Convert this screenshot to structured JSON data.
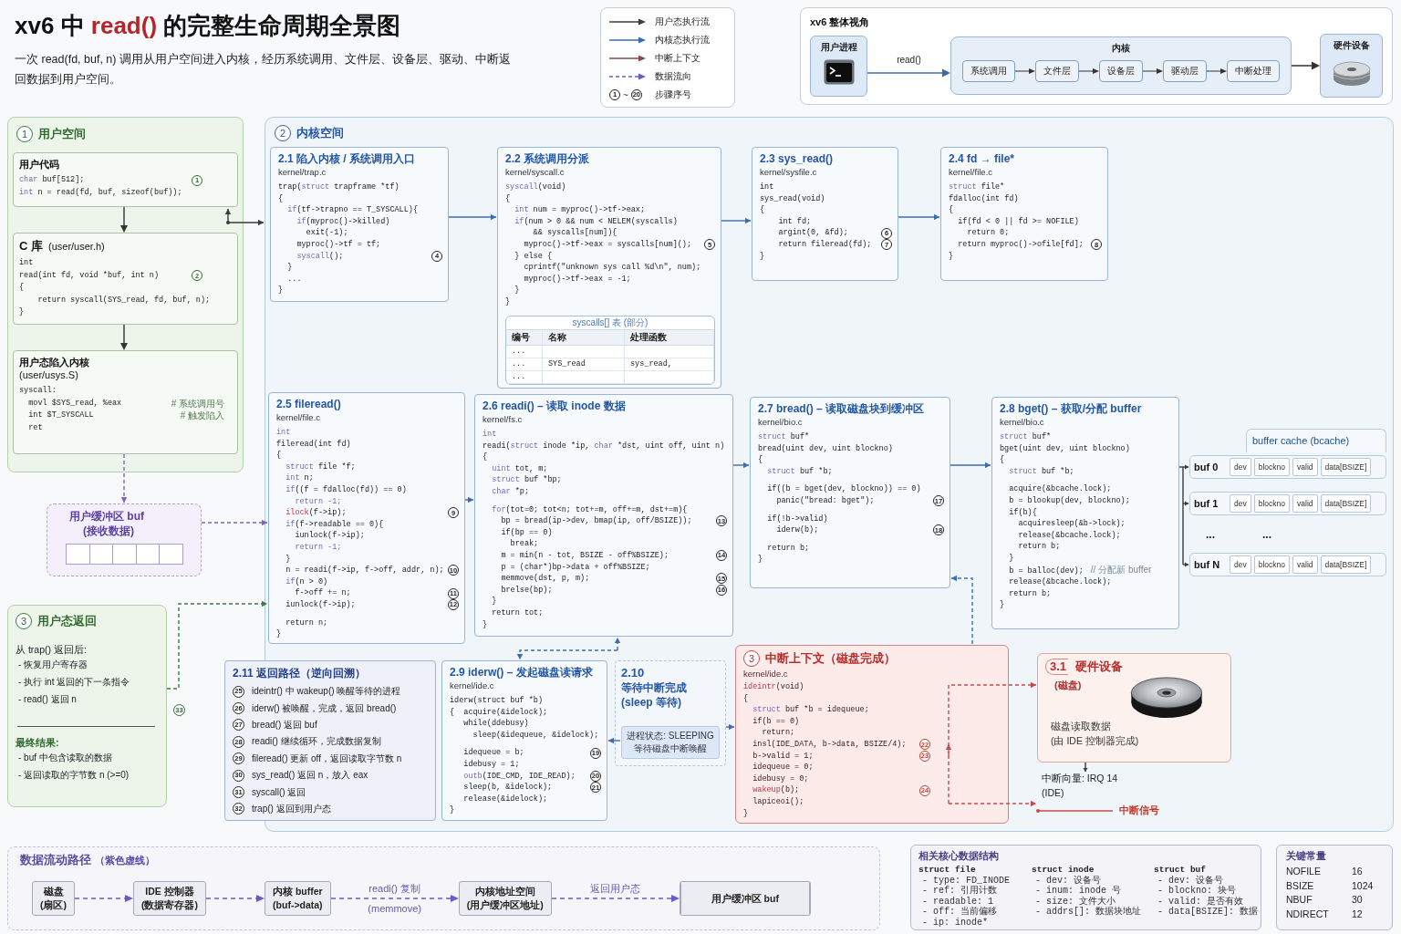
{
  "header": {
    "title_lead": "xv6 中",
    "title_code": "read()",
    "title_rest": "的完整生命周期全景图",
    "subtitle": "一次 read(fd, buf, n) 调用从用户空间进入内核，经历系统调用、文件层、设备层、驱动、中断返回数据到用户空间。"
  },
  "legend": {
    "items": [
      {
        "kind": "user",
        "label": "用户态执行流"
      },
      {
        "kind": "kernel",
        "label": "内核态执行流"
      },
      {
        "kind": "interrupt",
        "label": "中断上下文"
      },
      {
        "kind": "data",
        "label": "数据流向"
      },
      {
        "kind": "steps",
        "first": "1",
        "between": "~",
        "last": "20",
        "label": "步骤序号"
      }
    ]
  },
  "overview": {
    "title": "xv6 整体视角",
    "process": {
      "label": "用户进程"
    },
    "call_label": "read()",
    "kernel": {
      "label": "内核",
      "layers": [
        "系统调用",
        "文件层",
        "设备层",
        "驱动层",
        "中断处理"
      ]
    },
    "hardware": {
      "label": "硬件设备"
    }
  },
  "user_space": {
    "number": "1",
    "title": "用户空间",
    "blocks": [
      {
        "kind": "snippet",
        "title": "用户代码",
        "code": [
          [
            {
              "parts": [
                {
                  "kind": "keyword",
                  "text": "char"
                },
                {
                  "kind": "plain",
                  "text": " buf[512];"
                }
              ],
              "step": "1"
            },
            {
              "parts": [
                {
                  "kind": "keyword",
                  "text": "int"
                },
                {
                  "kind": "plain",
                  "text": " n = read(fd, buf, sizeof(buf));"
                }
              ]
            }
          ]
        ]
      },
      {
        "kind": "library",
        "title": "C 库",
        "path": "(user/user.h)",
        "code": [
          [
            "int",
            {
              "text": "read(int fd, void *buf, int n)",
              "step": "2"
            },
            "{",
            "    return syscall(SYS_read, fd, buf, n);",
            "}"
          ]
        ]
      },
      {
        "kind": "stub",
        "title": "用户态陷入内核",
        "path": "(user/usys.S)",
        "code": [
          [
            "syscall:",
            {
              "parts": [
                {
                  "kind": "plain",
                  "text": "  movl $SYS_read, %eax"
                },
                {
                  "kind": "note",
                  "text": "# 系统调用号"
                }
              ]
            },
            {
              "parts": [
                {
                  "kind": "plain",
                  "text": "  int $T_SYSCALL"
                },
                {
                  "kind": "note",
                  "text": "# 触发陷入"
                }
              ]
            },
            "  ret"
          ]
        ]
      }
    ]
  },
  "user_buffer": {
    "title": "用户缓冲区 buf",
    "subtitle": "(接收数据)"
  },
  "user_return": {
    "number": "3",
    "title": "用户态返回",
    "intro": "从 trap() 返回后:",
    "steps": [
      "- 恢复用户寄存器",
      "- 执行 int 返回的下一条指令",
      "- read() 返回 n"
    ],
    "result_title": "最终结果:",
    "results": [
      "- buf 中包含读取的数据",
      "- 返回读取的字节数 n (>=0)"
    ],
    "step": "33"
  },
  "kernel_space": {
    "number": "2",
    "title": "内核空间",
    "cards": [
      {
        "title": "2.1 陷入内核 / 系统调用入口",
        "file": "kernel/trap.c",
        "code": [
          [
            {
              "parts": [
                {
                  "kind": "plain",
                  "text": "trap("
                },
                {
                  "kind": "keyword",
                  "text": "struct"
                },
                {
                  "kind": "plain",
                  "text": " trapframe *tf)"
                }
              ]
            },
            "{",
            {
              "parts": [
                {
                  "kind": "keyword",
                  "text": "  if"
                },
                {
                  "kind": "plain",
                  "text": "(tf->trapno == T_SYSCALL){"
                }
              ]
            },
            {
              "parts": [
                {
                  "kind": "keyword",
                  "text": "    if"
                },
                {
                  "kind": "plain",
                  "text": "(myproc()->killed)"
                }
              ]
            },
            "      exit(-1);",
            "    myproc()->tf = tf;",
            {
              "parts": [
                {
                  "kind": "keyword",
                  "text": "    syscall"
                },
                {
                  "kind": "plain",
                  "text": "();"
                }
              ],
              "step": "4"
            },
            "  }",
            "  ...",
            "}"
          ]
        ]
      },
      {
        "title": "2.2 系统调用分派",
        "file": "kernel/syscall.c",
        "code": [
          [
            {
              "parts": [
                {
                  "kind": "keyword",
                  "text": "syscall"
                },
                {
                  "kind": "plain",
                  "text": "(void)"
                }
              ]
            },
            "{",
            {
              "parts": [
                {
                  "kind": "keyword",
                  "text": "  int"
                },
                {
                  "kind": "plain",
                  "text": " num = myproc()->tf->eax;"
                }
              ]
            },
            {
              "parts": [
                {
                  "kind": "keyword",
                  "text": "  if"
                },
                {
                  "kind": "plain",
                  "text": "(num > 0 && num < NELEM(syscalls)"
                }
              ]
            },
            "      && syscalls[num]){",
            {
              "text": "    myproc()->tf->eax = syscalls[num]();",
              "step": "5"
            },
            "  } else {",
            "    cprintf(\"unknown sys call %d\\n\", num);",
            "    myproc()->tf->eax = -1;",
            "  }",
            "}"
          ]
        ],
        "table": {
          "caption": "syscalls[] 表 (部分)",
          "columns": [
            "编号",
            "名称",
            "处理函数"
          ],
          "rows": [
            [
              "..."
            ],
            [
              "...",
              "SYS_read",
              "sys_read,"
            ],
            [
              "..."
            ]
          ]
        }
      },
      {
        "title": "2.3 sys_read()",
        "file": "kernel/sysfile.c",
        "code": [
          [
            "int",
            "sys_read(void)",
            "{",
            "    int fd;",
            {
              "text": "    argint(0, &fd);",
              "step": "6"
            },
            {
              "text": "    return fileread(fd);",
              "step": "7"
            },
            "}"
          ]
        ]
      },
      {
        "title": "2.4 fd → file*",
        "file": "kernel/file.c",
        "code": [
          [
            {
              "parts": [
                {
                  "kind": "keyword",
                  "text": "struct"
                },
                {
                  "kind": "plain",
                  "text": " file*"
                }
              ]
            },
            "fdalloc(int fd)",
            "{",
            "  if(fd < 0 || fd >= NOFILE)",
            "    return 0;",
            {
              "text": "  return myproc()->ofile[fd];",
              "step": "8"
            },
            "}"
          ]
        ]
      },
      {
        "title": "2.5 fileread()",
        "file": "kernel/file.c",
        "code": [
          [
            {
              "parts": [
                {
                  "kind": "keyword",
                  "text": "int"
                }
              ]
            },
            "fileread(int fd)",
            "{",
            {
              "parts": [
                {
                  "kind": "keyword",
                  "text": "  struct"
                },
                {
                  "kind": "plain",
                  "text": " file *f;"
                }
              ]
            },
            {
              "parts": [
                {
                  "kind": "keyword",
                  "text": "  int"
                },
                {
                  "kind": "plain",
                  "text": " n;"
                }
              ]
            },
            {
              "parts": [
                {
                  "kind": "keyword",
                  "text": "  if"
                },
                {
                  "kind": "plain",
                  "text": "((f = fdalloc(fd)) == 0)"
                }
              ]
            },
            {
              "parts": [
                {
                  "kind": "keyword",
                  "text": "    return -1;"
                }
              ]
            },
            {
              "parts": [
                {
                  "kind": "call",
                  "text": "  ilock"
                },
                {
                  "kind": "plain",
                  "text": "(f->ip);"
                }
              ],
              "step": "9"
            },
            {
              "parts": [
                {
                  "kind": "keyword",
                  "text": "  if"
                },
                {
                  "kind": "plain",
                  "text": "(f->readable == 0){"
                }
              ]
            },
            "    iunlock(f->ip);",
            {
              "parts": [
                {
                  "kind": "keyword",
                  "text": "    return -1;"
                }
              ]
            },
            "  }",
            {
              "text": "  n = readi(f->ip, f->off, addr, n);",
              "step": "10"
            },
            {
              "parts": [
                {
                  "kind": "keyword",
                  "text": "  if"
                },
                {
                  "kind": "plain",
                  "text": "(n > 0)"
                }
              ]
            },
            {
              "text": "    f->off += n;",
              "step": "11"
            },
            {
              "text": "  iunlock(f->ip);",
              "step": "12"
            }
          ],
          [
            "  return n;",
            "}"
          ]
        ]
      },
      {
        "title": "2.6 readi() – 读取 inode 数据",
        "file": "kernel/fs.c",
        "code": [
          [
            {
              "parts": [
                {
                  "kind": "keyword",
                  "text": "int"
                }
              ]
            },
            {
              "parts": [
                {
                  "kind": "plain",
                  "text": "readi("
                },
                {
                  "kind": "keyword",
                  "text": "struct"
                },
                {
                  "kind": "plain",
                  "text": " inode *ip, "
                },
                {
                  "kind": "keyword",
                  "text": "char"
                },
                {
                  "kind": "plain",
                  "text": " *dst, uint off, uint n)"
                }
              ]
            },
            "{",
            {
              "parts": [
                {
                  "kind": "keyword",
                  "text": "  uint"
                },
                {
                  "kind": "plain",
                  "text": " tot, m;"
                }
              ]
            },
            {
              "parts": [
                {
                  "kind": "keyword",
                  "text": "  struct"
                },
                {
                  "kind": "plain",
                  "text": " buf *bp;"
                }
              ]
            },
            {
              "parts": [
                {
                  "kind": "keyword",
                  "text": "  char"
                },
                {
                  "kind": "plain",
                  "text": " *p;"
                }
              ]
            }
          ],
          [
            {
              "parts": [
                {
                  "kind": "keyword",
                  "text": "  for"
                },
                {
                  "kind": "plain",
                  "text": "(tot=0; tot<n; tot+=m, off+=m, dst+=m){"
                }
              ]
            },
            {
              "text": "    bp = bread(ip->dev, bmap(ip, off/BSIZE));",
              "step": "13"
            },
            "    if(bp == 0)",
            "      break;",
            {
              "text": "    m = min(n - tot, BSIZE - off%BSIZE);",
              "step": "14"
            },
            "    p = (char*)bp->data + off%BSIZE;",
            {
              "text": "    memmove(dst, p, m);",
              "step": "15"
            },
            {
              "text": "    brelse(bp);",
              "step": "16"
            },
            "  }",
            "  return tot;",
            "}"
          ]
        ]
      },
      {
        "title": "2.7 bread() – 读取磁盘块到缓冲区",
        "file": "kernel/bio.c",
        "code": [
          [
            {
              "parts": [
                {
                  "kind": "keyword",
                  "text": "struct"
                },
                {
                  "kind": "plain",
                  "text": " buf*"
                }
              ]
            },
            "bread(uint dev, uint blockno)",
            "{",
            {
              "parts": [
                {
                  "kind": "keyword",
                  "text": "  struct"
                },
                {
                  "kind": "plain",
                  "text": " buf *b;"
                }
              ]
            }
          ],
          [
            "  if((b = bget(dev, blockno)) == 0)",
            {
              "text": "    panic(\"bread: bget\");",
              "step": "17"
            }
          ],
          [
            "  if(!b->valid)",
            {
              "text": "    iderw(b);",
              "step": "18"
            }
          ],
          [
            "  return b;",
            "}"
          ]
        ]
      },
      {
        "title": "2.8 bget() – 获取/分配 buffer",
        "file": "kernel/bio.c",
        "code": [
          [
            {
              "parts": [
                {
                  "kind": "keyword",
                  "text": "struct"
                },
                {
                  "kind": "plain",
                  "text": " buf*"
                }
              ]
            },
            "bget(uint dev, uint blockno)",
            "{",
            {
              "parts": [
                {
                  "kind": "keyword",
                  "text": "  struct"
                },
                {
                  "kind": "plain",
                  "text": " buf *b;"
                }
              ]
            }
          ],
          [
            "  acquire(&bcache.lock);",
            "  b = blookup(dev, blockno);",
            "  if(b){",
            "    acquiresleep(&b->lock);",
            "    release(&bcache.lock);",
            "    return b;",
            "  }",
            {
              "parts": [
                {
                  "kind": "plain",
                  "text": "  b = balloc(dev);"
                },
                {
                  "kind": "comment",
                  "text": "// 分配新 buffer"
                }
              ]
            },
            "  release(&bcache.lock);",
            "  return b;",
            "}"
          ]
        ]
      },
      {
        "title": "2.9 iderw() – 发起磁盘读请求",
        "file": "kernel/ide.c",
        "code": [
          [
            "iderw(struct buf *b)",
            "{  acquire(&idelock);",
            "   while(ddebusy)",
            "     sleep(&idequeue, &idelock);"
          ],
          [
            {
              "text": "   idequeue = b;",
              "step": "19"
            },
            "   idebusy = 1;",
            {
              "parts": [
                {
                  "kind": "keyword",
                  "text": "   outb"
                },
                {
                  "kind": "plain",
                  "text": "(IDE_CMD, IDE_READ);"
                }
              ],
              "step": "20"
            },
            {
              "text": "   sleep(b, &idelock);",
              "step": "21"
            },
            "   release(&idelock);",
            "}"
          ]
        ]
      }
    ],
    "buffer_cache": {
      "title": "buffer cache (bcache)",
      "entries": [
        {
          "name": "buf 0",
          "fields": [
            "dev",
            "blockno",
            "valid",
            "data[BSIZE]"
          ]
        },
        {
          "name": "buf 1",
          "fields": [
            "dev",
            "blockno",
            "valid",
            "data[BSIZE]"
          ]
        },
        {
          "name": "buf N",
          "fields": [
            "dev",
            "blockno",
            "valid",
            "data[BSIZE]"
          ]
        }
      ],
      "ellipsis": [
        "...",
        "..."
      ]
    },
    "wait_state": {
      "title": "2.10",
      "lines": [
        "等待中断完成",
        "(sleep 等待)"
      ],
      "status": [
        "进程状态: SLEEPING",
        "等待磁盘中断唤醒"
      ]
    },
    "return_path": {
      "title": "2.11 返回路径（逆向回溯）",
      "steps": [
        {
          "step": "25",
          "text": "ideintr() 中 wakeup() 唤醒等待的进程"
        },
        {
          "step": "26",
          "text": "iderw() 被唤醒，完成，返回 bread()"
        },
        {
          "step": "27",
          "text": "bread() 返回 buf"
        },
        {
          "step": "28",
          "text": "readi() 继续循环，完成数据复制"
        },
        {
          "step": "29",
          "text": "fileread() 更新 off，返回读取字节数 n"
        },
        {
          "step": "30",
          "text": "sys_read() 返回 n，放入 eax"
        },
        {
          "step": "31",
          "text": "syscall() 返回"
        },
        {
          "step": "32",
          "text": "trap() 返回到用户态"
        }
      ]
    }
  },
  "interrupt_context": {
    "number": "3",
    "title": "中断上下文（磁盘完成）",
    "file": "kernel/ide.c",
    "code": [
      [
        {
          "parts": [
            {
              "kind": "call",
              "text": "ideintr"
            },
            {
              "kind": "plain",
              "text": "(void)"
            }
          ]
        },
        "{",
        {
          "parts": [
            {
              "kind": "keyword",
              "text": "  struct"
            },
            {
              "kind": "plain",
              "text": " buf *b = idequeue;"
            }
          ]
        },
        "  if(b == 0)",
        "    return;",
        {
          "text": "  insl(IDE_DATA, b->data, BSIZE/4);",
          "step": "22"
        },
        {
          "text": "  b->valid = 1;",
          "step": "23"
        },
        "  idequeue = 0;",
        "  idebusy = 0;",
        {
          "parts": [
            {
              "kind": "call",
              "text": "  wakeup"
            },
            {
              "kind": "plain",
              "text": "(b);"
            }
          ],
          "step": "24"
        },
        "  lapiceoi();",
        "}"
      ]
    ]
  },
  "hardware": {
    "number": "3.1",
    "title": "硬件设备",
    "subtitle": "(磁盘)",
    "lines": [
      "磁盘读取数据",
      "(由 IDE 控制器完成)"
    ],
    "irq": [
      "中断向量: IRQ 14",
      "(IDE)"
    ],
    "signal": "中断信号"
  },
  "data_flow": {
    "title": "数据流动路径",
    "note": "（紫色虚线）",
    "nodes": [
      {
        "kind": "stage",
        "lines": [
          "磁盘",
          "(扇区)"
        ]
      },
      {
        "kind": "stage",
        "lines": [
          "IDE 控制器",
          "(数据寄存器)"
        ]
      },
      {
        "kind": "stage",
        "lines": [
          "内核 buffer",
          "(buf->data)"
        ]
      },
      {
        "kind": "stage",
        "lines": [
          "内核地址空间",
          "(用户缓冲区地址)"
        ],
        "label_above": "readi() 复制",
        "label_below": "(memmove)"
      },
      {
        "kind": "buffer",
        "lines": [
          "用户缓冲区 buf"
        ],
        "label_above": "返回用户态"
      }
    ]
  },
  "data_structures": {
    "title": "相关核心数据结构",
    "structs": [
      {
        "name": "struct file",
        "fields": [
          "- type: FD_INODE",
          "- ref: 引用计数",
          "- readable: 1",
          "- off: 当前偏移",
          "- ip: inode*"
        ]
      },
      {
        "name": "struct inode",
        "fields": [
          "- dev: 设备号",
          "- inum: inode 号",
          "- size: 文件大小",
          "- addrs[]: 数据块地址"
        ]
      },
      {
        "name": "struct buf",
        "fields": [
          "- dev: 设备号",
          "- blockno: 块号",
          "- valid: 是否有效",
          "- data[BSIZE]: 数据"
        ]
      }
    ]
  },
  "constants": {
    "title": "关键常量",
    "items": [
      {
        "name": "NOFILE",
        "value": "16"
      },
      {
        "name": "BSIZE",
        "value": "1024"
      },
      {
        "name": "NBUF",
        "value": "30"
      },
      {
        "name": "NDIRECT",
        "value": "12"
      }
    ]
  }
}
